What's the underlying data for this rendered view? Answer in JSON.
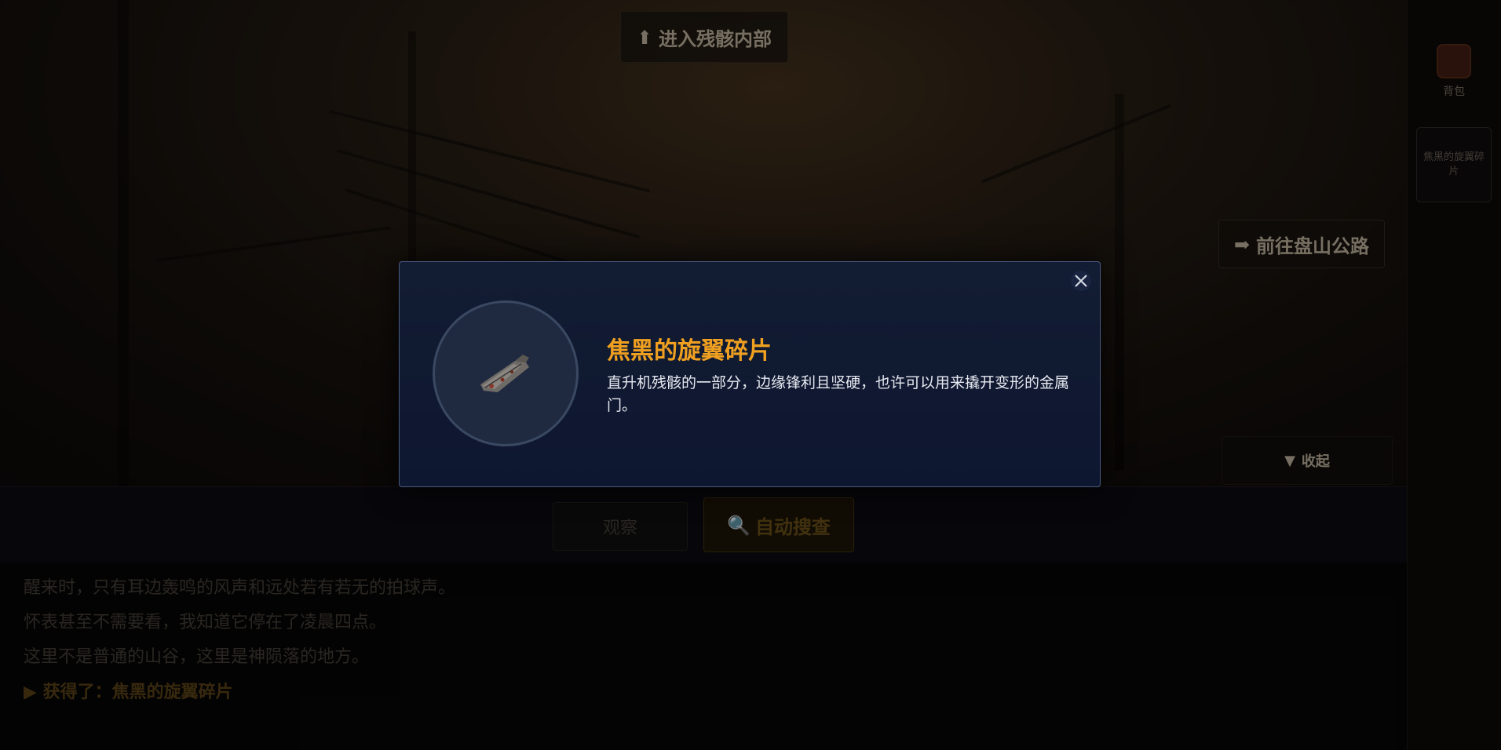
{
  "scene": {
    "enter_button": "进入残骸内部",
    "road_button": "前往盘山公路",
    "collapse_button": "收起"
  },
  "sidebar": {
    "bag_label": "背包",
    "slot_label": "焦黑的旋翼碎片"
  },
  "actions": {
    "look_label": "观察",
    "search_label": "自动搜查"
  },
  "log": [
    "醒来时，只有耳边轰鸣的风声和远处若有若无的拍球声。",
    "怀表甚至不需要看，我知道它停在了凌晨四点。",
    "这里不是普通的山谷，这里是神陨落的地方。",
    "获得了：焦黑的旋翼碎片"
  ],
  "modal": {
    "title": "焦黑的旋翼碎片",
    "description": "直升机残骸的一部分，边缘锋利且坚硬，也许可以用来撬开变形的金属门。",
    "close_icon": "close-icon",
    "item_icon": "rotor-fragment-icon"
  },
  "colors": {
    "modal_bg": "#101a30",
    "title_accent": "#f0a020",
    "modal_border": "#4b5a80"
  }
}
